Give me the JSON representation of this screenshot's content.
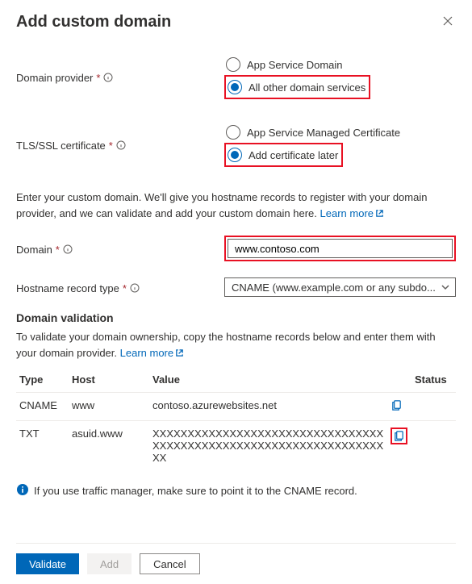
{
  "title": "Add custom domain",
  "domain_provider": {
    "label": "Domain provider",
    "options": {
      "app_service": "App Service Domain",
      "other": "All other domain services"
    },
    "selected": "other"
  },
  "tls": {
    "label": "TLS/SSL certificate",
    "options": {
      "managed": "App Service Managed Certificate",
      "later": "Add certificate later"
    },
    "selected": "later"
  },
  "desc": {
    "text": "Enter your custom domain. We'll give you hostname records to register with your domain provider, and we can validate and add your custom domain here.",
    "learn_more": "Learn more"
  },
  "domain": {
    "label": "Domain",
    "value": "www.contoso.com"
  },
  "hostname_type": {
    "label": "Hostname record type",
    "value": "CNAME (www.example.com or any subdo..."
  },
  "validation": {
    "heading": "Domain validation",
    "text": "To validate your domain ownership, copy the hostname records below and enter them with your domain provider.",
    "learn_more": "Learn more"
  },
  "table": {
    "headers": {
      "type": "Type",
      "host": "Host",
      "value": "Value",
      "status": "Status"
    },
    "rows": [
      {
        "type": "CNAME",
        "host": "www",
        "value": "contoso.azurewebsites.net",
        "highlight_copy": false
      },
      {
        "type": "TXT",
        "host": "asuid.www",
        "value": "XXXXXXXXXXXXXXXXXXXXXXXXXXXXXXXXXXXXXXXXXXXXXXXXXXXXXXXXXXXXXXXXXXXX",
        "highlight_copy": true
      }
    ]
  },
  "note": "If you use traffic manager, make sure to point it to the CNAME record.",
  "buttons": {
    "validate": "Validate",
    "add": "Add",
    "cancel": "Cancel"
  }
}
